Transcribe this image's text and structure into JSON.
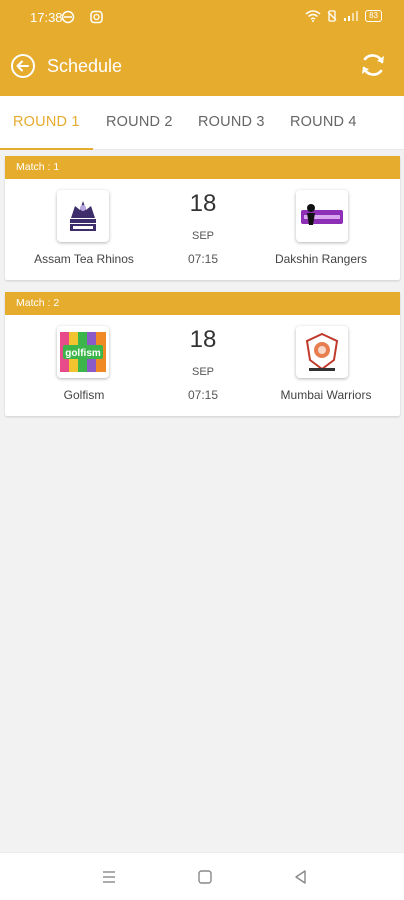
{
  "status_bar": {
    "time": "17:38",
    "battery": "83"
  },
  "header": {
    "title": "Schedule"
  },
  "tabs": [
    {
      "label": "ROUND 1",
      "active": true
    },
    {
      "label": "ROUND 2",
      "active": false
    },
    {
      "label": "ROUND 3",
      "active": false
    },
    {
      "label": "ROUND 4",
      "active": false
    }
  ],
  "matches": [
    {
      "header": "Match : 1",
      "team1": {
        "name": "Assam Tea Rhinos",
        "logo": "rhinos-logo"
      },
      "team2": {
        "name": "Dakshin Rangers",
        "logo": "rangers-logo"
      },
      "day": "18",
      "month": "SEP",
      "time": "07:15"
    },
    {
      "header": "Match : 2",
      "team1": {
        "name": "Golfism",
        "logo": "golfism-logo",
        "logo_text": "golfism"
      },
      "team2": {
        "name": "Mumbai Warriors",
        "logo": "warriors-logo"
      },
      "day": "18",
      "month": "SEP",
      "time": "07:15"
    }
  ],
  "colors": {
    "accent": "#e6ac2e",
    "background": "#f2f2f2"
  }
}
